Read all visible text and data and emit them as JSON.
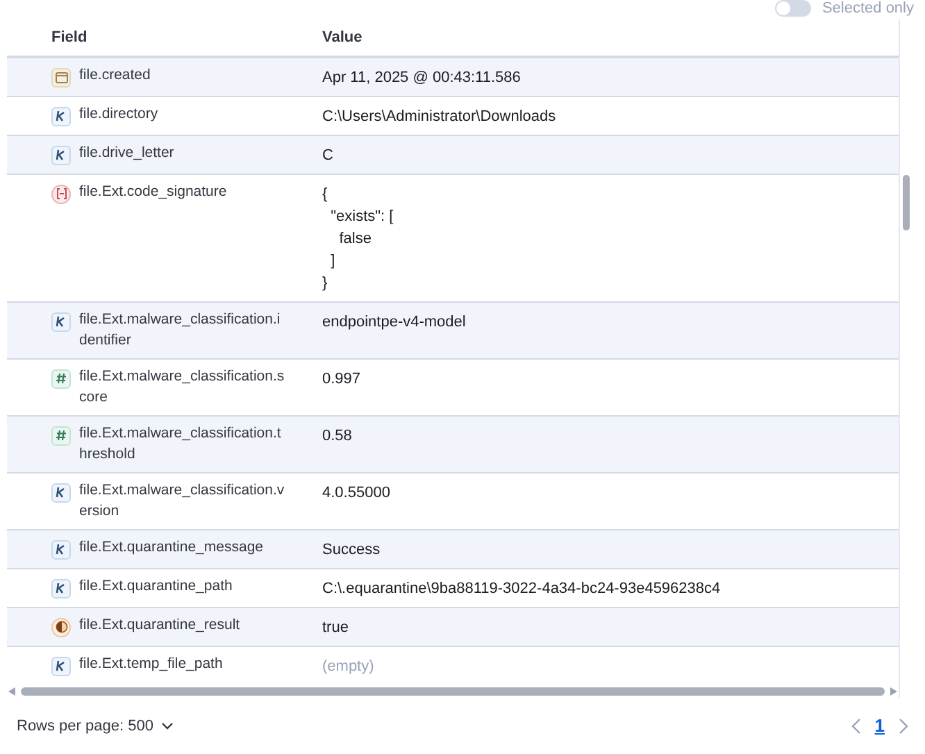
{
  "toggle": {
    "label": "Selected only",
    "on": false
  },
  "table": {
    "columns": [
      "Field",
      "Value"
    ],
    "rows": [
      {
        "kind": "date",
        "field": "file.created",
        "value": "Apr 11, 2025 @ 00:43:11.586"
      },
      {
        "kind": "keyword",
        "field": "file.directory",
        "value": "C:\\Users\\Administrator\\Downloads"
      },
      {
        "kind": "keyword",
        "field": "file.drive_letter",
        "value": "C"
      },
      {
        "kind": "nested",
        "field": "file.Ext.code_signature",
        "value": "{\n  \"exists\": [\n    false\n  ]\n}"
      },
      {
        "kind": "keyword",
        "field": "file.Ext.malware_classification.identifier",
        "value": "endpointpe-v4-model"
      },
      {
        "kind": "number",
        "field": "file.Ext.malware_classification.score",
        "value": "0.997"
      },
      {
        "kind": "number",
        "field": "file.Ext.malware_classification.threshold",
        "value": "0.58"
      },
      {
        "kind": "keyword",
        "field": "file.Ext.malware_classification.version",
        "value": "4.0.55000"
      },
      {
        "kind": "keyword",
        "field": "file.Ext.quarantine_message",
        "value": "Success"
      },
      {
        "kind": "keyword",
        "field": "file.Ext.quarantine_path",
        "value": "C:\\.equarantine\\9ba88119-3022-4a34-bc24-93e4596238c4"
      },
      {
        "kind": "boolean",
        "field": "file.Ext.quarantine_result",
        "value": "true"
      },
      {
        "kind": "keyword",
        "field": "file.Ext.temp_file_path",
        "value": "(empty)",
        "empty": true
      }
    ]
  },
  "footer": {
    "rows_per_page": "Rows per page: 500",
    "pages": [
      {
        "label": "1",
        "selected": true
      }
    ]
  }
}
